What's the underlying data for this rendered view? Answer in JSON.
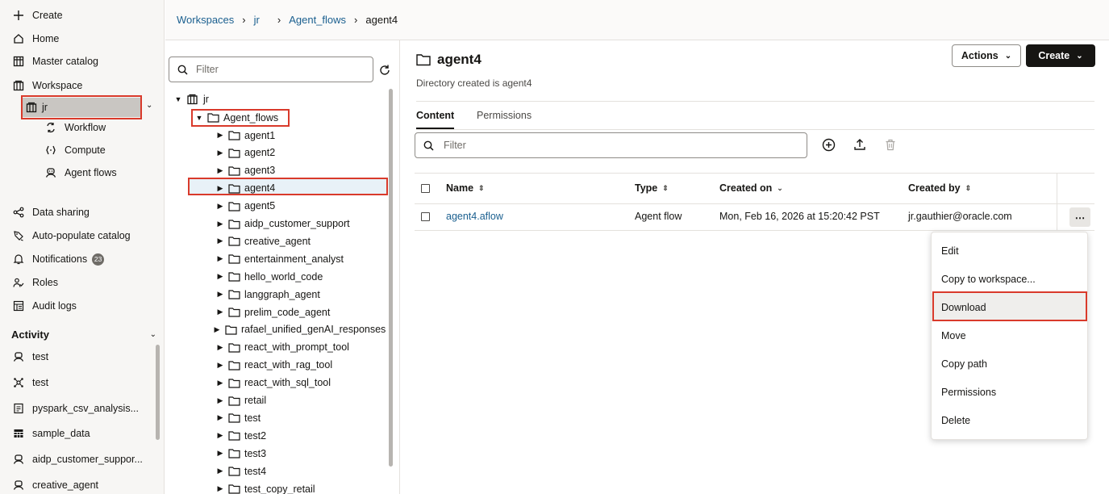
{
  "nav": {
    "top": [
      {
        "icon": "plus-icon",
        "label": "Create"
      },
      {
        "icon": "home-icon",
        "label": "Home"
      },
      {
        "icon": "catalog-icon",
        "label": "Master catalog"
      },
      {
        "icon": "workspace-icon",
        "label": "Workspace"
      }
    ],
    "workspace_current": "jr",
    "workspace_children": [
      {
        "icon": "workflow-icon",
        "label": "Workflow"
      },
      {
        "icon": "compute-icon",
        "label": "Compute"
      },
      {
        "icon": "agent-flows-icon",
        "label": "Agent flows"
      }
    ],
    "middle": [
      {
        "icon": "share-icon",
        "label": "Data sharing"
      },
      {
        "icon": "auto-populate-icon",
        "label": "Auto-populate catalog"
      },
      {
        "icon": "bell-icon",
        "label": "Notifications",
        "badge": "23"
      },
      {
        "icon": "roles-icon",
        "label": "Roles"
      },
      {
        "icon": "audit-icon",
        "label": "Audit logs"
      }
    ],
    "activity_title": "Activity",
    "activity": [
      {
        "icon": "agent-icon",
        "label": "test"
      },
      {
        "icon": "workflow-node-icon",
        "label": "test"
      },
      {
        "icon": "notebook-icon",
        "label": "pyspark_csv_analysis..."
      },
      {
        "icon": "table-icon",
        "label": "sample_data"
      },
      {
        "icon": "agent-icon",
        "label": "aidp_customer_suppor..."
      },
      {
        "icon": "agent-icon",
        "label": "creative_agent"
      }
    ]
  },
  "breadcrumb": {
    "items": [
      "Workspaces",
      "jr",
      "Agent_flows"
    ],
    "current": "agent4"
  },
  "tree": {
    "filter_placeholder": "Filter",
    "root": "jr",
    "agent_flows": "Agent_flows",
    "folders": [
      "agent1",
      "agent2",
      "agent3",
      "agent4",
      "agent5",
      "aidp_customer_support",
      "creative_agent",
      "entertainment_analyst",
      "hello_world_code",
      "langgraph_agent",
      "prelim_code_agent",
      "rafael_unified_genAI_responses",
      "react_with_prompt_tool",
      "react_with_rag_tool",
      "react_with_sql_tool",
      "retail",
      "test",
      "test2",
      "test3",
      "test4",
      "test_copy_retail"
    ]
  },
  "main": {
    "title": "agent4",
    "subtitle": "Directory created is agent4",
    "actions_label": "Actions",
    "create_label": "Create",
    "tabs": [
      "Content",
      "Permissions"
    ],
    "filter_placeholder": "Filter",
    "columns": [
      "Name",
      "Type",
      "Created on",
      "Created by"
    ],
    "rows": [
      {
        "name": "agent4.aflow",
        "type": "Agent flow",
        "created_on": "Mon, Feb 16, 2026 at 15:20:42 PST",
        "created_by": "jr.gauthier@oracle.com"
      }
    ]
  },
  "menu": {
    "items": [
      "Edit",
      "Copy to workspace...",
      "Download",
      "Move",
      "Copy path",
      "Permissions",
      "Delete"
    ],
    "highlighted": "Download"
  },
  "colors": {
    "link": "#1a5f8f",
    "highlight_box": "#d93a2b",
    "primary_button": "#161513"
  }
}
